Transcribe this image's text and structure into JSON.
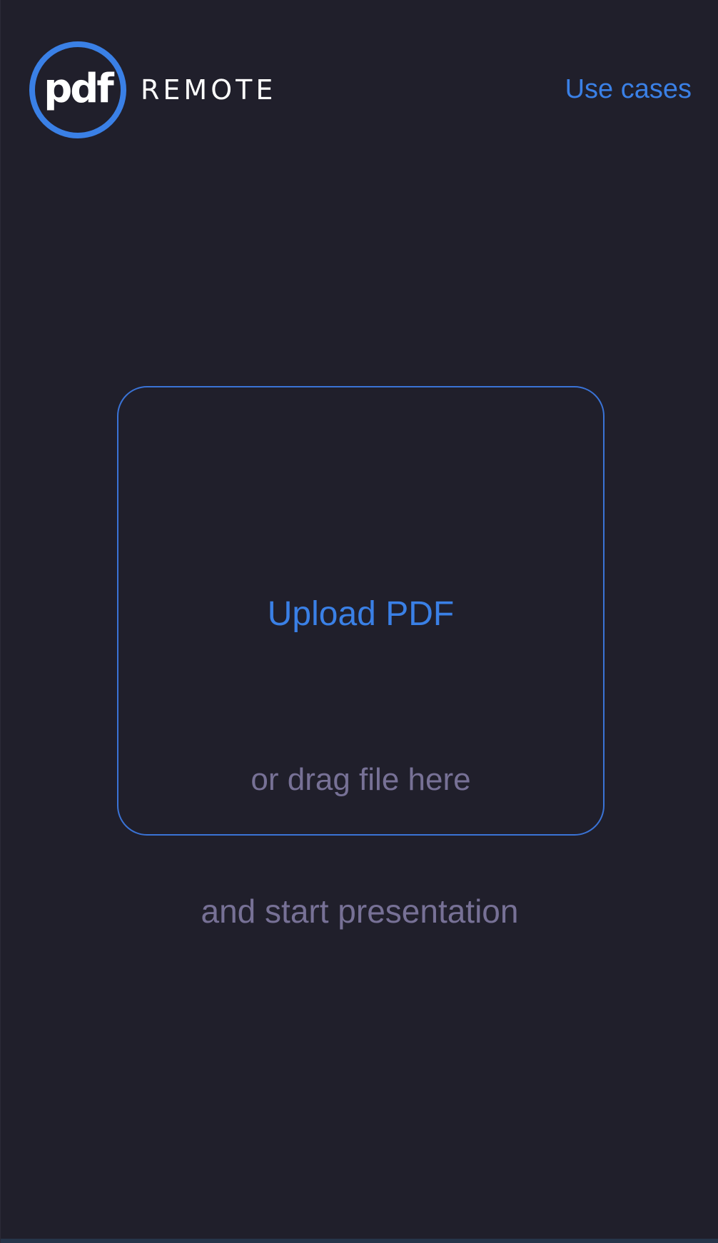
{
  "header": {
    "logo": {
      "mark_text": "pdf",
      "wordmark": "REMOTE"
    },
    "nav": {
      "use_cases_label": "Use cases"
    }
  },
  "dropzone": {
    "upload_label": "Upload PDF",
    "drag_label": "or drag file here"
  },
  "tagline": "and start presentation",
  "colors": {
    "background": "#201f2b",
    "accent": "#3a80e6",
    "muted_text": "#777196"
  }
}
